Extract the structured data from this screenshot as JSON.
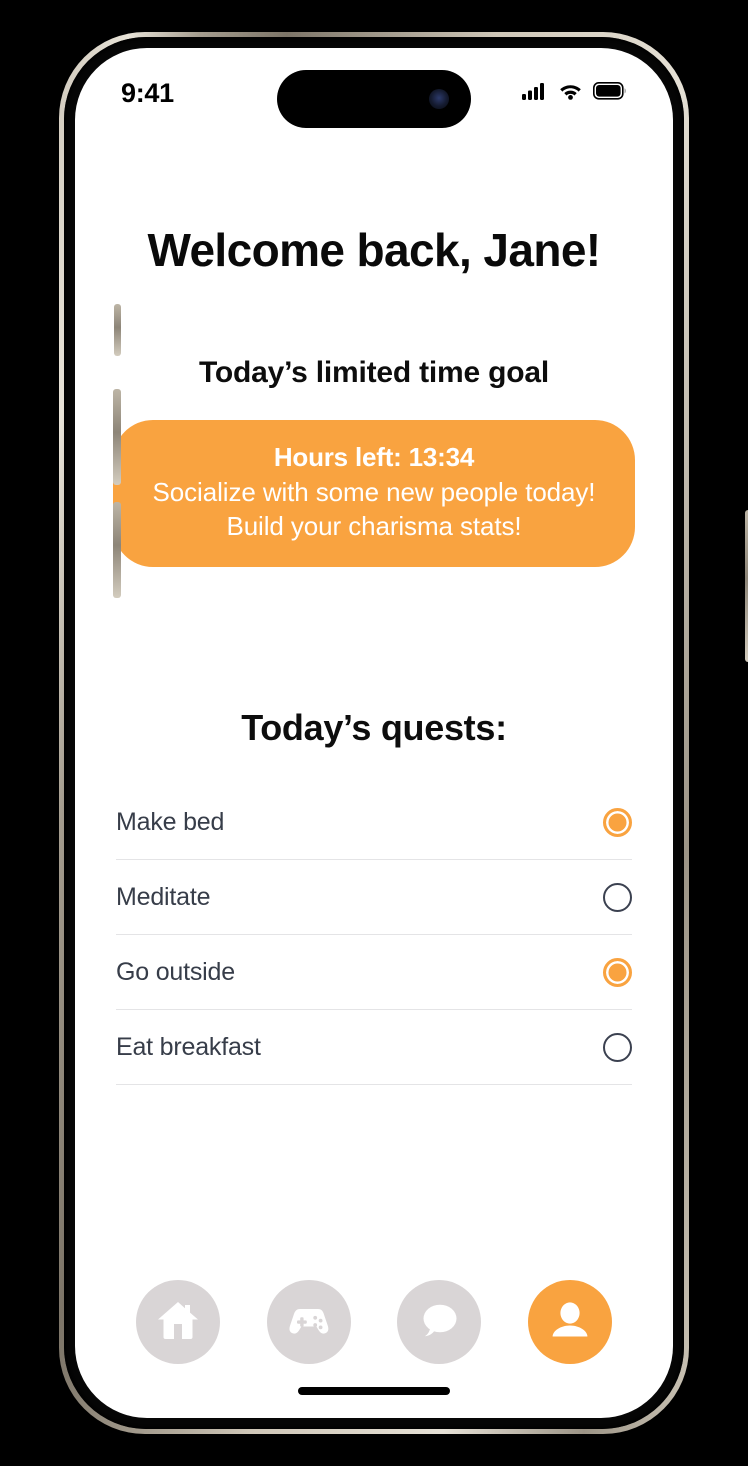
{
  "accent_color": "#f9a340",
  "status_bar": {
    "time": "9:41",
    "icons": [
      "cellular-signal-icon",
      "wifi-icon",
      "battery-icon"
    ]
  },
  "header": {
    "welcome_title": "Welcome back, Jane!",
    "goal_heading": "Today’s limited time goal"
  },
  "goal_card": {
    "hours_left": "Hours left: 13:34",
    "description": "Socialize with some new people today! Build your charisma stats!"
  },
  "quests": {
    "heading": "Today’s quests:",
    "items": [
      {
        "label": "Make bed",
        "completed": true
      },
      {
        "label": "Meditate",
        "completed": false
      },
      {
        "label": "Go outside",
        "completed": true
      },
      {
        "label": "Eat breakfast",
        "completed": false
      }
    ]
  },
  "bottom_nav": {
    "items": [
      {
        "name": "home",
        "icon": "house-icon",
        "active": false
      },
      {
        "name": "games",
        "icon": "game-controller-icon",
        "active": false
      },
      {
        "name": "chat",
        "icon": "chat-bubble-icon",
        "active": false
      },
      {
        "name": "profile",
        "icon": "person-icon",
        "active": true
      }
    ]
  }
}
